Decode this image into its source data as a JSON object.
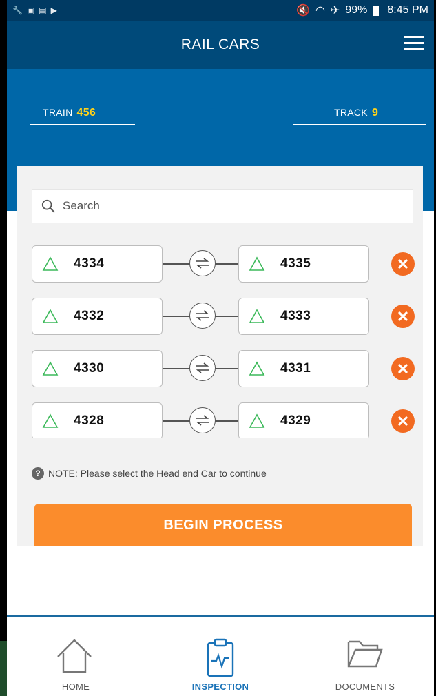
{
  "status_bar": {
    "battery": "99%",
    "time": "8:45 PM"
  },
  "header": {
    "title": "RAIL CARS"
  },
  "train": {
    "label": "TRAIN",
    "value": "456"
  },
  "track": {
    "label": "TRACK",
    "value": "9"
  },
  "search": {
    "placeholder": "Search"
  },
  "car_pairs": [
    {
      "left": "4334",
      "right": "4335"
    },
    {
      "left": "4332",
      "right": "4333"
    },
    {
      "left": "4330",
      "right": "4331"
    },
    {
      "left": "4328",
      "right": "4329"
    }
  ],
  "note": "NOTE: Please select the Head end Car to continue",
  "begin_button": "BEGIN PROCESS",
  "nav": {
    "home": "HOME",
    "inspection": "INSPECTION",
    "documents": "DOCUMENTS"
  },
  "colors": {
    "accent": "#fb8c2c",
    "header": "#004a7a",
    "band": "#0067a8",
    "highlight": "#ffd21a",
    "remove": "#f26a21",
    "active_nav": "#1a73b8"
  }
}
